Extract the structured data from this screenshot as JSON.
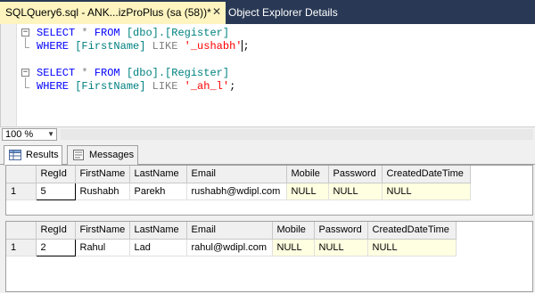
{
  "tabs": {
    "active_title": "SQLQuery6.sql - ANK...izProPlus (sa (58))*",
    "close_glyph": "✕",
    "inactive_title": "Object Explorer Details"
  },
  "editor": {
    "block1": {
      "select": "SELECT",
      "star": "*",
      "from": "FROM",
      "table": "[dbo].[Register]",
      "where": "WHERE",
      "column": "[FirstName]",
      "like": "LIKE",
      "pattern": "'_ushabh'",
      "semicolon": ";"
    },
    "block2": {
      "select": "SELECT",
      "star": "*",
      "from": "FROM",
      "table": "[dbo].[Register]",
      "where": "WHERE",
      "column": "[FirstName]",
      "like": "LIKE",
      "pattern": "'_ah_l'",
      "semicolon": ";"
    }
  },
  "zoom": {
    "value": "100 %"
  },
  "results_tabs": [
    {
      "label": "Results",
      "icon": "grid-icon"
    },
    {
      "label": "Messages",
      "icon": "messages-icon"
    }
  ],
  "grid1": {
    "columns": [
      "RegId",
      "FirstName",
      "LastName",
      "Email",
      "Mobile",
      "Password",
      "CreatedDateTime"
    ],
    "rows": [
      {
        "rownum": "1",
        "RegId": "5",
        "FirstName": "Rushabh",
        "LastName": "Parekh",
        "Email": "rushabh@wdipl.com",
        "Mobile": "NULL",
        "Password": "NULL",
        "CreatedDateTime": "NULL"
      }
    ]
  },
  "grid2": {
    "columns": [
      "RegId",
      "FirstName",
      "LastName",
      "Email",
      "Mobile",
      "Password",
      "CreatedDateTime"
    ],
    "rows": [
      {
        "rownum": "1",
        "RegId": "2",
        "FirstName": "Rahul",
        "LastName": "Lad",
        "Email": "rahul@wdipl.com",
        "Mobile": "NULL",
        "Password": "NULL",
        "CreatedDateTime": "NULL"
      }
    ]
  },
  "colors": {
    "chrome": "#293955",
    "active_tab": "#fdf4bf",
    "keyword": "#0000ff",
    "identifier": "#008080",
    "string": "#ff0000",
    "null_cell": "#ffffe1"
  }
}
